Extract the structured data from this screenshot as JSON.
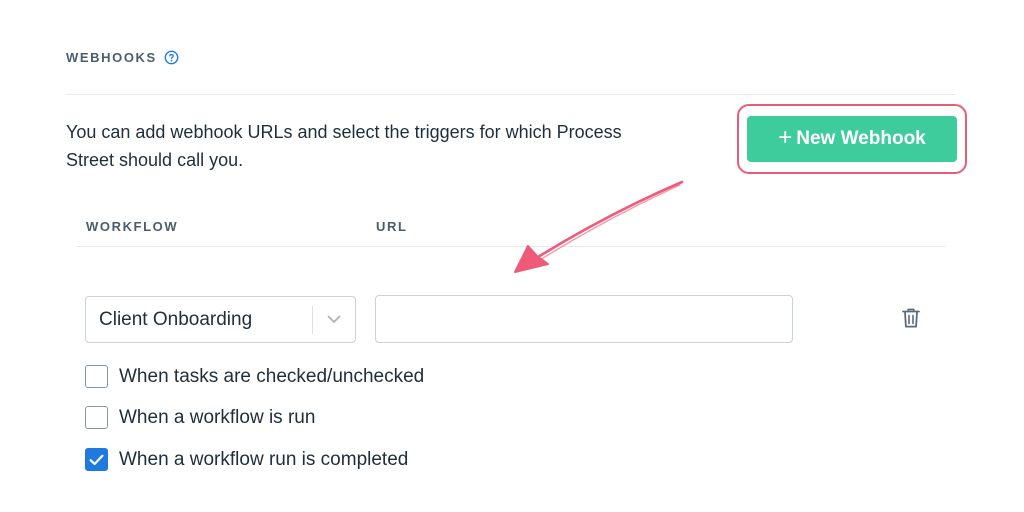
{
  "section": {
    "title": "WEBHOOKS"
  },
  "description": "You can add webhook URLs and select the triggers for which Process Street should call you.",
  "new_webhook_button": {
    "label": "New Webhook"
  },
  "table": {
    "columns": [
      "WORKFLOW",
      "URL"
    ]
  },
  "webhook": {
    "workflow": "Client Onboarding",
    "url_value": "",
    "url_placeholder": ""
  },
  "triggers": [
    {
      "label": "When tasks are checked/unchecked",
      "checked": false
    },
    {
      "label": "When a workflow is run",
      "checked": false
    },
    {
      "label": "When a workflow run is completed",
      "checked": true
    }
  ],
  "colors": {
    "accent_green": "#3fcc9c",
    "highlight_red": "#e85d75",
    "checkbox_blue": "#1f7ae0"
  },
  "icons": [
    "help-circle-icon",
    "plus-icon",
    "chevron-down-icon",
    "trash-icon",
    "checkmark-icon",
    "annotation-arrow"
  ]
}
